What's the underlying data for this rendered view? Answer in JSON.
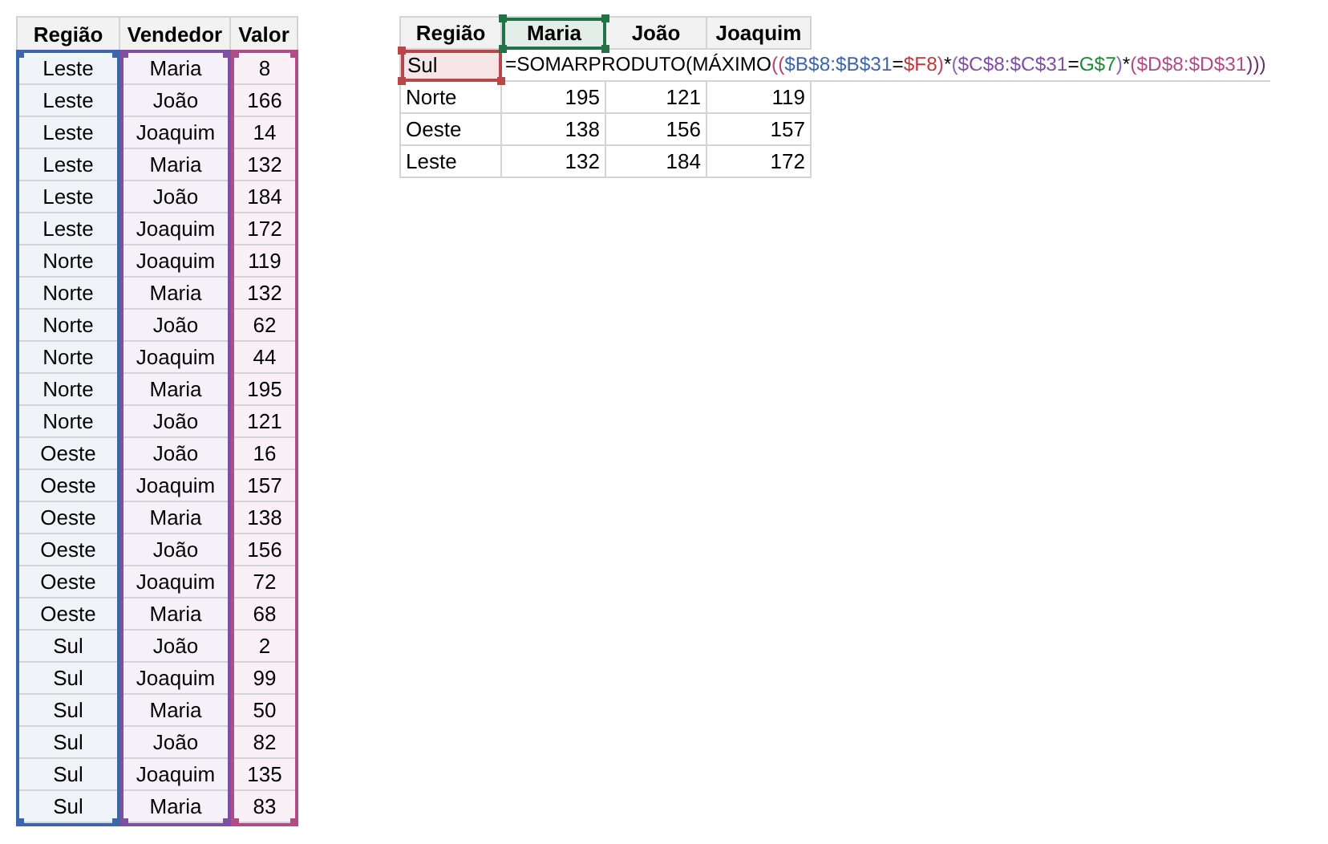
{
  "data_table": {
    "columns": [
      {
        "label": "Região",
        "color": "#3d66aa"
      },
      {
        "label": "Vendedor",
        "color": "#7f4fa3"
      },
      {
        "label": "Valor",
        "color": "#b24c86"
      }
    ],
    "rows": [
      [
        "Leste",
        "Maria",
        "8"
      ],
      [
        "Leste",
        "João",
        "166"
      ],
      [
        "Leste",
        "Joaquim",
        "14"
      ],
      [
        "Leste",
        "Maria",
        "132"
      ],
      [
        "Leste",
        "João",
        "184"
      ],
      [
        "Leste",
        "Joaquim",
        "172"
      ],
      [
        "Norte",
        "Joaquim",
        "119"
      ],
      [
        "Norte",
        "Maria",
        "132"
      ],
      [
        "Norte",
        "João",
        "62"
      ],
      [
        "Norte",
        "Joaquim",
        "44"
      ],
      [
        "Norte",
        "Maria",
        "195"
      ],
      [
        "Norte",
        "João",
        "121"
      ],
      [
        "Oeste",
        "João",
        "16"
      ],
      [
        "Oeste",
        "Joaquim",
        "157"
      ],
      [
        "Oeste",
        "Maria",
        "138"
      ],
      [
        "Oeste",
        "João",
        "156"
      ],
      [
        "Oeste",
        "Joaquim",
        "72"
      ],
      [
        "Oeste",
        "Maria",
        "68"
      ],
      [
        "Sul",
        "João",
        "2"
      ],
      [
        "Sul",
        "Joaquim",
        "99"
      ],
      [
        "Sul",
        "Maria",
        "50"
      ],
      [
        "Sul",
        "João",
        "82"
      ],
      [
        "Sul",
        "Joaquim",
        "135"
      ],
      [
        "Sul",
        "Maria",
        "83"
      ]
    ]
  },
  "summary_table": {
    "columns": [
      {
        "label": "Região",
        "referenced": false
      },
      {
        "label": "Maria",
        "referenced": true,
        "color": "#217346"
      },
      {
        "label": "João",
        "referenced": false
      },
      {
        "label": "Joaquim",
        "referenced": false
      }
    ],
    "rows": [
      {
        "region": "Sul",
        "referenced": true,
        "color": "#b8474a",
        "formula": [
          {
            "text": "=SOMARPRODUTO(MÁXIMO",
            "color": "#000000"
          },
          {
            "text": "((",
            "color": "#b04a6a"
          },
          {
            "text": "$B$8:$B$31",
            "color": "#3d66aa"
          },
          {
            "text": "=",
            "color": "#000000"
          },
          {
            "text": "$F8",
            "color": "#c0393b"
          },
          {
            "text": ")",
            "color": "#b04a6a"
          },
          {
            "text": "*",
            "color": "#000000"
          },
          {
            "text": "(",
            "color": "#8a6aae"
          },
          {
            "text": "$C$8:$C$31",
            "color": "#7f4fa3"
          },
          {
            "text": "=",
            "color": "#000000"
          },
          {
            "text": "G$7",
            "color": "#1e8a3a"
          },
          {
            "text": ")",
            "color": "#8a6aae"
          },
          {
            "text": "*",
            "color": "#000000"
          },
          {
            "text": "(",
            "color": "#b24c86"
          },
          {
            "text": "$D$8:$D$31",
            "color": "#b24c86"
          },
          {
            "text": ")))",
            "color": "#6a3070"
          }
        ]
      },
      {
        "region": "Norte",
        "referenced": false,
        "values": [
          "195",
          "121",
          "119"
        ]
      },
      {
        "region": "Oeste",
        "referenced": false,
        "values": [
          "138",
          "156",
          "157"
        ]
      },
      {
        "region": "Leste",
        "referenced": false,
        "values": [
          "132",
          "184",
          "172"
        ]
      }
    ]
  }
}
